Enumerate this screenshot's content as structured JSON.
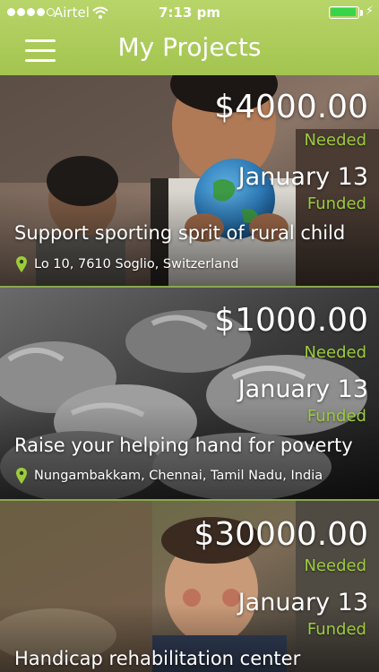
{
  "status_bar": {
    "carrier": "Airtel",
    "time": "7:13 pm",
    "signal_bars_filled": 4,
    "signal_bars_total": 5,
    "battery_level": 0.9,
    "battery_color": "#37d64a"
  },
  "nav": {
    "title": "My Projects",
    "menu_icon": "hamburger-menu-icon"
  },
  "colors": {
    "accent_green": "#a3c44f",
    "status_green": "#9ccc3c"
  },
  "projects": [
    {
      "amount": "$4000.00",
      "needed_label": "Needed",
      "date": "January 13",
      "funded_label": "Funded",
      "title": "Support sporting sprit of rural child",
      "location": "Lo 10, 7610 Soglio, Switzerland"
    },
    {
      "amount": "$1000.00",
      "needed_label": "Needed",
      "date": "January 13",
      "funded_label": "Funded",
      "title": "Raise your helping hand for poverty",
      "location": "Nungambakkam, Chennai, Tamil Nadu, India"
    },
    {
      "amount": "$30000.00",
      "needed_label": "Needed",
      "date": "January 13",
      "funded_label": "Funded",
      "title": "Handicap rehabilitation center",
      "location": ""
    }
  ]
}
